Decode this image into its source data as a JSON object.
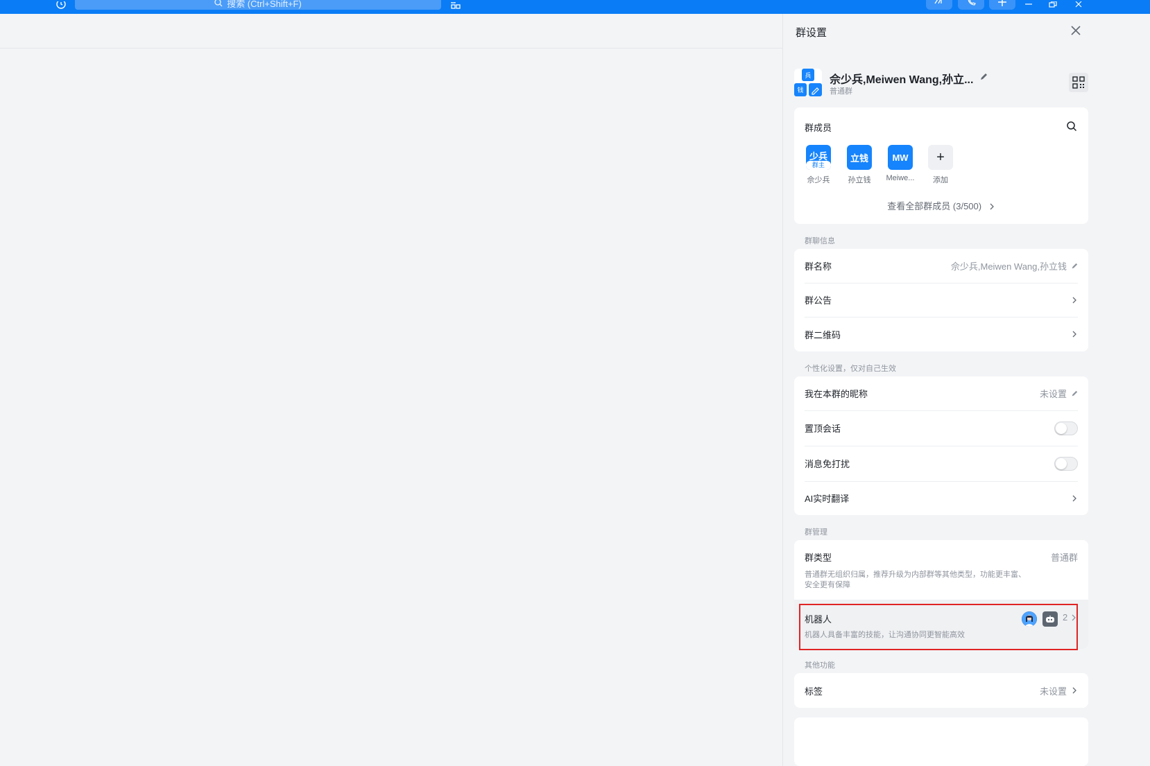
{
  "topbar": {
    "search_placeholder": "搜索 (Ctrl+Shift+F)",
    "colors": {
      "bar": "#0a7cf6"
    }
  },
  "panel": {
    "title": "群设置",
    "group": {
      "name": "佘少兵,Meiwen Wang,孙立...",
      "type": "普通群",
      "avatar_chars": [
        "兵",
        "钱"
      ]
    },
    "members": {
      "title": "群成员",
      "list": [
        {
          "avatar_text": "少兵",
          "badge": "群主",
          "name": "佘少兵"
        },
        {
          "avatar_text": "立钱",
          "name": "孙立钱"
        },
        {
          "avatar_text": "MW",
          "name": "Meiwe..."
        },
        {
          "avatar_text": "+",
          "name": "添加"
        }
      ],
      "view_all": "查看全部群成员 (3/500)"
    },
    "info_section": {
      "label": "群聊信息",
      "rows": [
        {
          "label": "群名称",
          "value": "佘少兵,Meiwen Wang,孙立钱"
        },
        {
          "label": "群公告"
        },
        {
          "label": "群二维码"
        }
      ]
    },
    "personal_section": {
      "label": "个性化设置，仅对自己生效",
      "rows": [
        {
          "label": "我在本群的昵称",
          "value": "未设置"
        },
        {
          "label": "置顶会话",
          "toggle": false
        },
        {
          "label": "消息免打扰",
          "toggle": false
        },
        {
          "label": "AI实时翻译"
        }
      ]
    },
    "manage_section": {
      "label": "群管理",
      "type_row": {
        "label": "群类型",
        "value": "普通群",
        "desc_line1": "普通群无组织归属，推荐升级为内部群等其他类型，功能更丰富、",
        "desc_line2": "安全更有保障"
      },
      "robot_row": {
        "label": "机器人",
        "desc": "机器人具备丰富的技能，让沟通协同更智能高效",
        "count": "2"
      }
    },
    "other_section": {
      "label": "其他功能",
      "rows": [
        {
          "label": "标签",
          "value": "未设置"
        }
      ]
    }
  },
  "colors": {
    "accent": "#1684fc",
    "highlight": "#e02424"
  }
}
